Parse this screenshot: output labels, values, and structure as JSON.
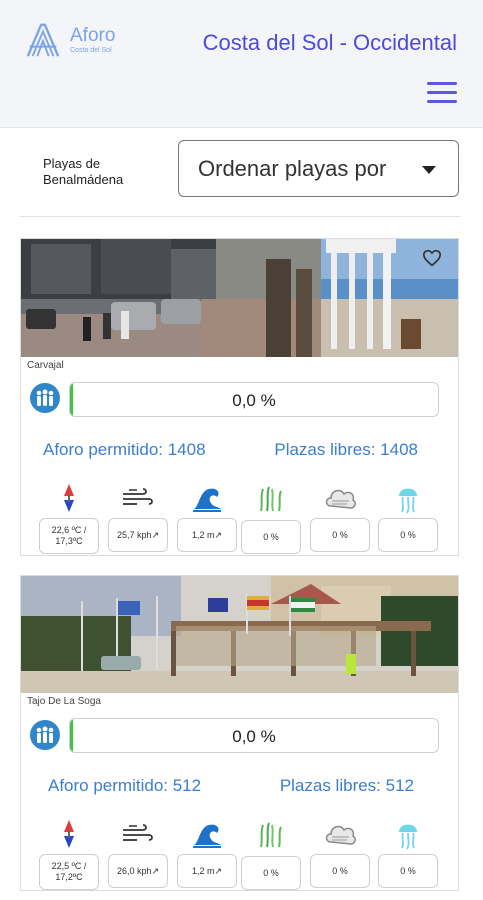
{
  "header": {
    "logo_main": "Aforo",
    "logo_sub": "Costa del Sol",
    "region_title": "Costa del Sol - Occidental"
  },
  "filter": {
    "label": "Playas de Benalmádena",
    "sort_label": "Ordenar playas por"
  },
  "beaches": [
    {
      "name": "Carvajal",
      "occupancy_text": "0,0 %",
      "occupancy_pct": 0,
      "allowed_text": "Aforo permitido: 1408",
      "free_text": "Plazas libres: 1408",
      "weather": {
        "temperature": "22,6 ºC / 17,3ºC",
        "wind": "25,7 kph",
        "waves": "1,2 m",
        "algae": "0 %",
        "cloud": "0 %",
        "jellyfish": "0 %"
      }
    },
    {
      "name": "Tajo De La Soga",
      "occupancy_text": "0,0 %",
      "occupancy_pct": 0,
      "allowed_text": "Aforo permitido: 512",
      "free_text": "Plazas libres: 512",
      "weather": {
        "temperature": "22,5 ºC / 17,2ºC",
        "wind": "26,0 kph",
        "waves": "1,2 m",
        "algae": "0 %",
        "cloud": "0 %",
        "jellyfish": "0 %"
      }
    }
  ],
  "icons": {
    "logo": "aforo-logo-icon",
    "menu": "hamburger-menu-icon",
    "caret": "caret-down-icon",
    "favorite": "heart-icon",
    "crowd": "people-icon",
    "temperature": "thermometer-icon",
    "wind": "wind-icon",
    "waves": "wave-icon",
    "algae": "seaweed-icon",
    "cloud": "cloud-icon",
    "jellyfish": "jellyfish-icon"
  },
  "colors": {
    "accent": "#4e4ad8",
    "link": "#3b7ecf",
    "progress": "#43c34a",
    "crowd_icon": "#2f86c9"
  }
}
